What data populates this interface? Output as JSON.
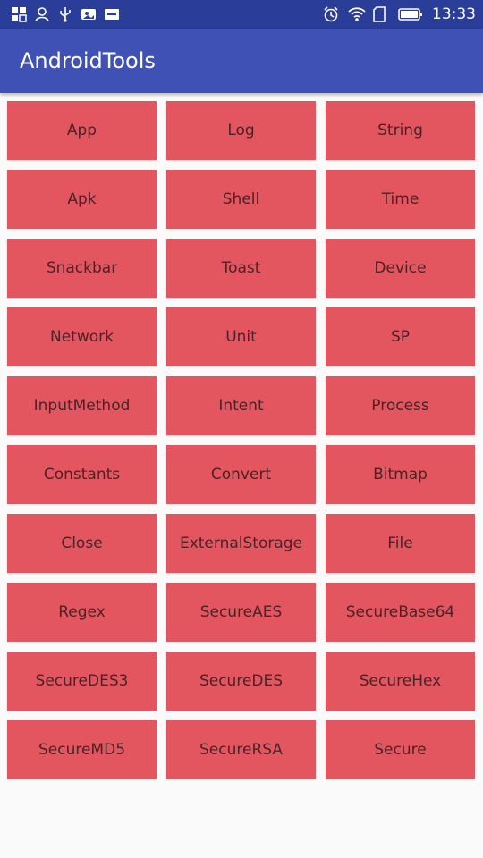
{
  "status_bar": {
    "left_icons": [
      "grid-app-icon",
      "person-icon",
      "usb-icon",
      "photo-icon",
      "badge-icon"
    ],
    "right_icons": [
      "alarm-icon",
      "wifi-icon",
      "sim-icon",
      "battery-icon"
    ],
    "time": "13:33"
  },
  "app_bar": {
    "title": "AndroidTools"
  },
  "tools": [
    "App",
    "Log",
    "String",
    "Apk",
    "Shell",
    "Time",
    "Snackbar",
    "Toast",
    "Device",
    "Network",
    "Unit",
    "SP",
    "InputMethod",
    "Intent",
    "Process",
    "Constants",
    "Convert",
    "Bitmap",
    "Close",
    "ExternalStorage",
    "File",
    "Regex",
    "SecureAES",
    "SecureBase64",
    "SecureDES3",
    "SecureDES",
    "SecureHex",
    "SecureMD5",
    "SecureRSA",
    "Secure"
  ],
  "colors": {
    "status_bar": "#2a3d99",
    "app_bar": "#3f51b5",
    "button": "#e35660",
    "button_text": "#4a2227",
    "background": "#fafafa"
  }
}
